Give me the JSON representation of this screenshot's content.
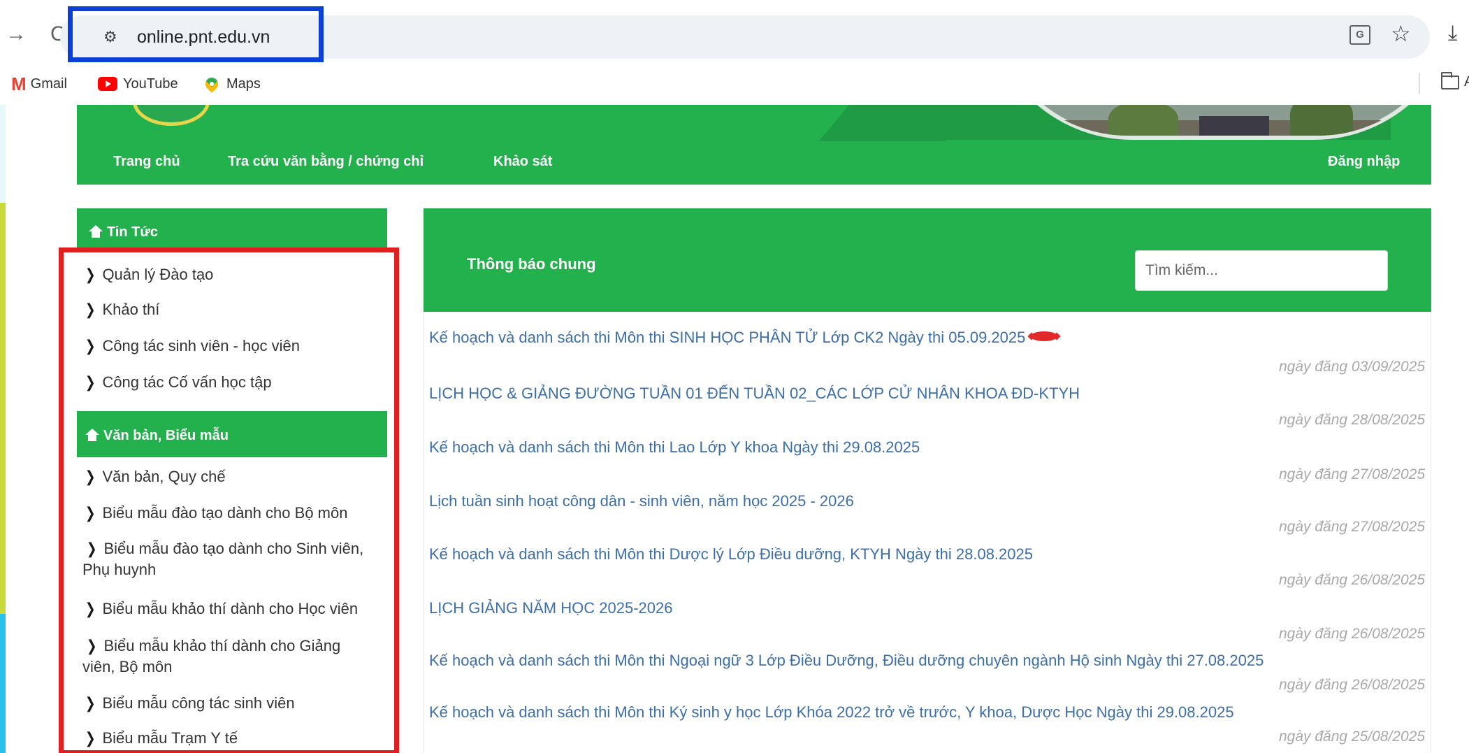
{
  "browser": {
    "url": "online.pnt.edu.vn",
    "bookmarks": [
      {
        "label": "Gmail"
      },
      {
        "label": "YouTube"
      },
      {
        "label": "Maps"
      }
    ],
    "bookmarks_overflow_label": "A"
  },
  "site": {
    "nav": [
      {
        "label": "Trang chủ"
      },
      {
        "label": "Tra cứu văn bằng / chứng chỉ"
      },
      {
        "label": "Khảo sát"
      }
    ],
    "login_label": "Đăng nhập"
  },
  "sidebar": {
    "sections": [
      {
        "title": "Tin Tức",
        "items": [
          {
            "label": "Quản lý Đào tạo"
          },
          {
            "label": "Khảo thí"
          },
          {
            "label": "Công tác sinh viên - học viên"
          },
          {
            "label": "Công tác Cố vấn học tập"
          }
        ]
      },
      {
        "title": "Văn bản, Biểu mẫu",
        "items": [
          {
            "label": "Văn bản, Quy chế"
          },
          {
            "label": "Biểu mẫu đào tạo dành cho Bộ môn"
          },
          {
            "label": "Biểu mẫu đào tạo dành cho Sinh viên, Phụ huynh"
          },
          {
            "label": "Biểu mẫu khảo thí dành cho Học viên"
          },
          {
            "label": "Biểu mẫu khảo thí dành cho Giảng viên, Bộ môn"
          },
          {
            "label": "Biểu mẫu công tác sinh viên"
          },
          {
            "label": "Biểu mẫu Trạm Y tế"
          }
        ]
      }
    ]
  },
  "main": {
    "panel_title": "Thông báo chung",
    "search_placeholder": "Tìm kiếm...",
    "news": [
      {
        "title": "Kế hoạch và danh sách thi Môn thi SINH HỌC PHÂN TỬ Lớp CK2 Ngày thi 05.09.2025",
        "date": "ngày đăng 03/09/2025",
        "is_new": true
      },
      {
        "title": "LỊCH HỌC & GIẢNG ĐƯỜNG TUẦN 01 ĐẾN TUẦN 02_CÁC LỚP CỬ NHÂN KHOA ĐD-KTYH",
        "date": "ngày đăng 28/08/2025"
      },
      {
        "title": "Kế hoạch và danh sách thi Môn thi Lao Lớp Y khoa Ngày thi 29.08.2025",
        "date": "ngày đăng 27/08/2025"
      },
      {
        "title": "Lịch tuần sinh hoạt công dân - sinh viên, năm học 2025 - 2026",
        "date": "ngày đăng 27/08/2025"
      },
      {
        "title": "Kế hoạch và danh sách thi Môn thi Dược lý Lớp Điều dưỡng, KTYH Ngày thi 28.08.2025",
        "date": "ngày đăng 26/08/2025"
      },
      {
        "title": "LỊCH GIẢNG NĂM HỌC 2025-2026",
        "date": "ngày đăng 26/08/2025"
      },
      {
        "title": "Kế hoạch và danh sách thi Môn thi Ngoại ngữ 3 Lớp Điều Dưỡng, Điều dưỡng chuyên ngành Hộ sinh Ngày thi 27.08.2025",
        "date": "ngày đăng 26/08/2025"
      },
      {
        "title": "Kế hoạch và danh sách thi Môn thi Ký sinh y học Lớp Khóa 2022 trở về trước, Y khoa, Dược Học Ngày thi 29.08.2025",
        "date": "ngày đăng 25/08/2025"
      }
    ]
  },
  "colors": {
    "brand_green": "#22b14c",
    "link_blue": "#3c6ea8",
    "highlight_blue": "#0a40d6",
    "highlight_red": "#e02020"
  }
}
